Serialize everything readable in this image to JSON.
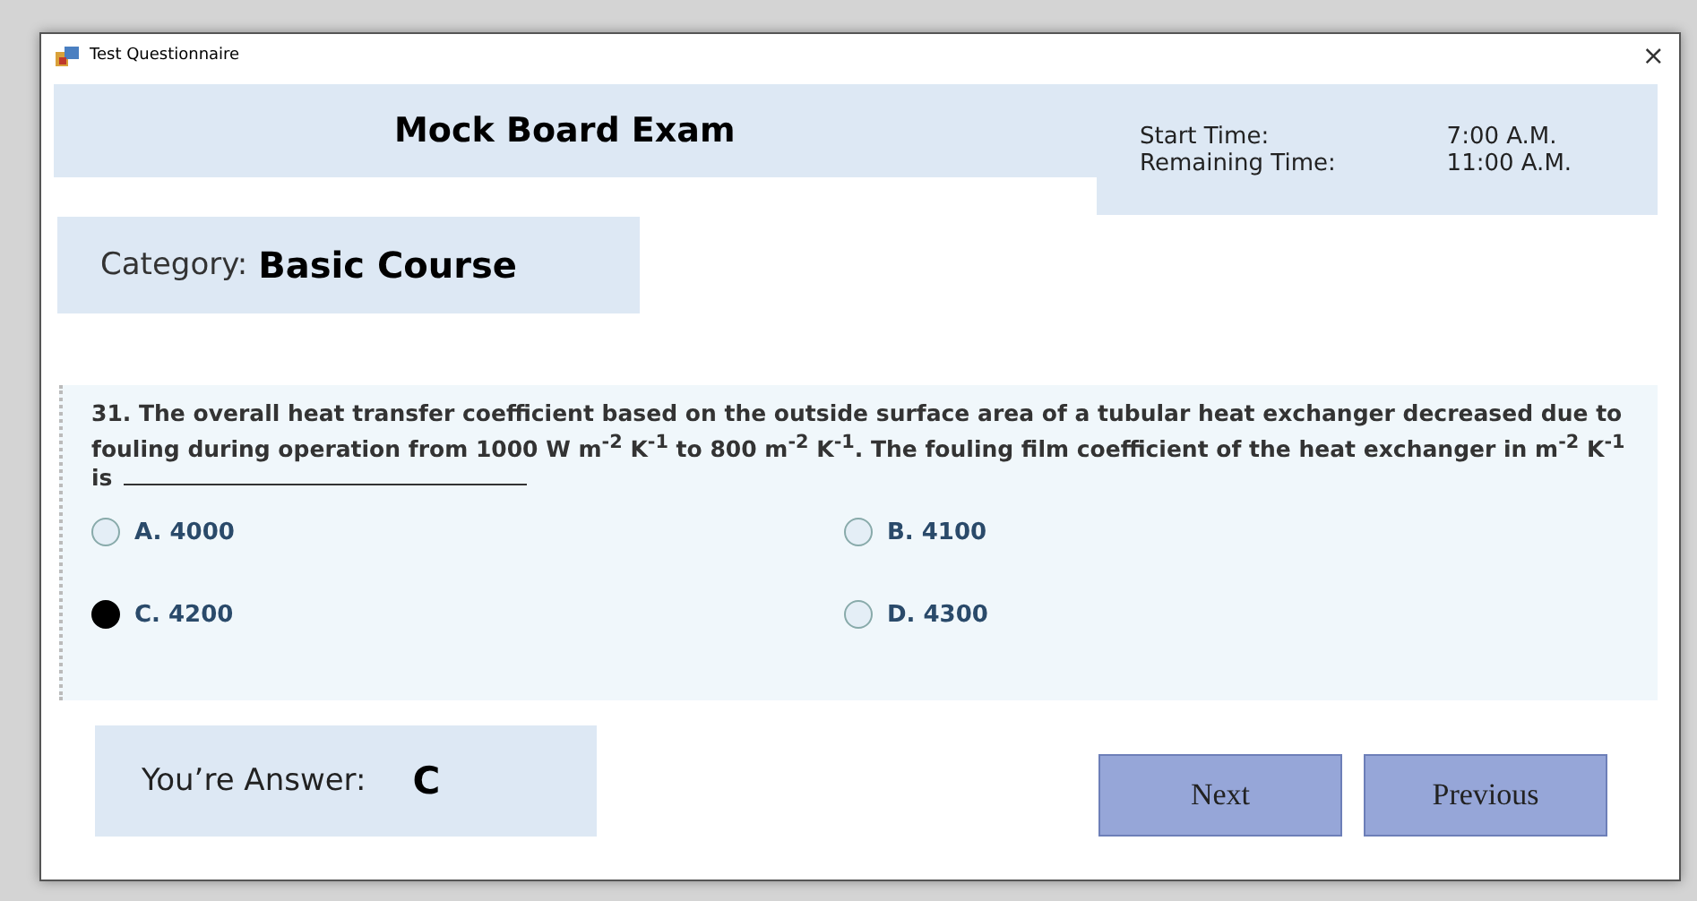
{
  "window": {
    "title": "Test Questionnaire",
    "close": "×"
  },
  "exam_title": "Mock Board Exam",
  "times": [
    {
      "label": "Start Time:",
      "value": "7:00 A.M."
    },
    {
      "label": "Remaining Time:",
      "value": "11:00 A.M."
    }
  ],
  "category": {
    "label": "Category:",
    "value": "Basic Course"
  },
  "question": {
    "text": "31. The overall heat transfer coefficient based on the outside surface area of a tubular heat exchanger decreased due to fouling during operation from 1000 W m$^{-2}$ K$^{-1}$ to 800 m$^{-2}$ K$^{-1}$. The fouling film coefficient of the heat exchanger in m$^{-2}$ K$^{-1}$ is",
    "options": [
      {
        "label": "A. 4000",
        "selected": false
      },
      {
        "label": "B. 4100",
        "selected": false
      },
      {
        "label": "C. 4200",
        "selected": true
      },
      {
        "label": "D. 4300",
        "selected": false
      }
    ]
  },
  "answer": {
    "label": "You’re Answer:",
    "value": "C"
  },
  "buttons": [
    "Next",
    "Previous"
  ]
}
